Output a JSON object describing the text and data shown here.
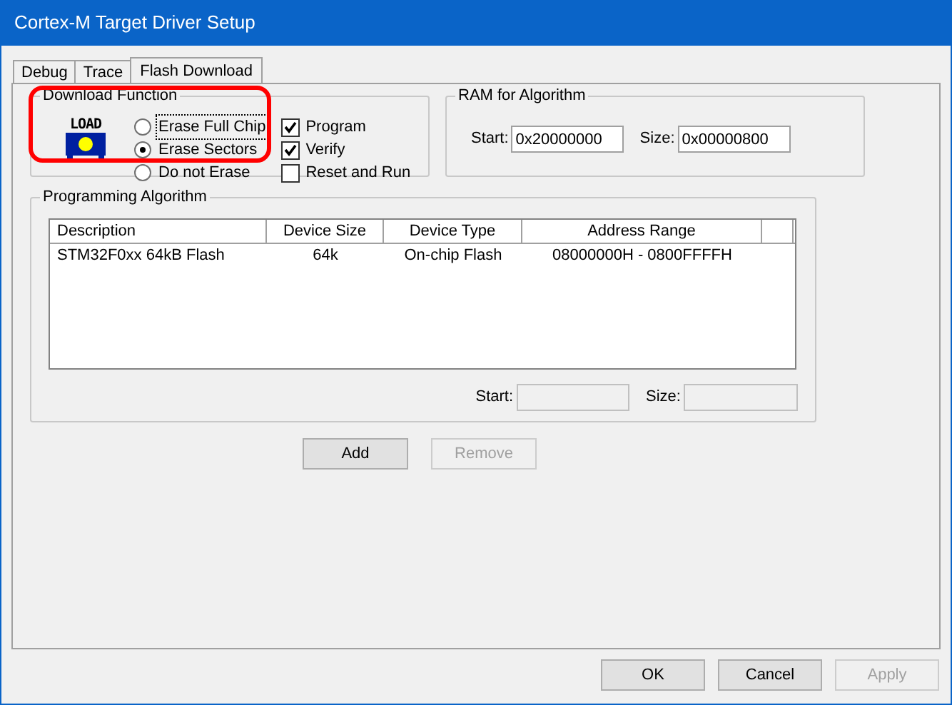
{
  "window": {
    "title": "Cortex-M Target Driver Setup"
  },
  "tabs": [
    {
      "label": "Debug",
      "selected": false
    },
    {
      "label": "Trace",
      "selected": false
    },
    {
      "label": "Flash Download",
      "selected": true
    }
  ],
  "download_function": {
    "title": "Download Function",
    "icon_text": "LOAD",
    "highlighted": true,
    "erase_options": [
      {
        "label": "Erase Full Chip",
        "selected": false,
        "focused": true
      },
      {
        "label": "Erase Sectors",
        "selected": true,
        "focused": false
      },
      {
        "label": "Do not Erase",
        "selected": false,
        "focused": false
      }
    ],
    "checkboxes": [
      {
        "label": "Program",
        "checked": true
      },
      {
        "label": "Verify",
        "checked": true
      },
      {
        "label": "Reset and Run",
        "checked": false
      }
    ]
  },
  "ram_for_algorithm": {
    "title": "RAM for Algorithm",
    "start_label": "Start:",
    "start": "0x20000000",
    "size_label": "Size:",
    "size": "0x00000800"
  },
  "programming_algorithm": {
    "title": "Programming Algorithm",
    "columns": [
      "Description",
      "Device Size",
      "Device Type",
      "Address Range"
    ],
    "rows": [
      [
        "STM32F0xx 64kB Flash",
        "64k",
        "On-chip Flash",
        "08000000H - 0800FFFFH"
      ]
    ],
    "start_label": "Start:",
    "size_label": "Size:"
  },
  "buttons": [
    {
      "label": "Add",
      "disabled": false
    },
    {
      "label": "Remove",
      "disabled": true
    }
  ],
  "footer_buttons": [
    {
      "label": "OK",
      "disabled": false
    },
    {
      "label": "Cancel",
      "disabled": false
    },
    {
      "label": "Apply",
      "disabled": true
    }
  ]
}
